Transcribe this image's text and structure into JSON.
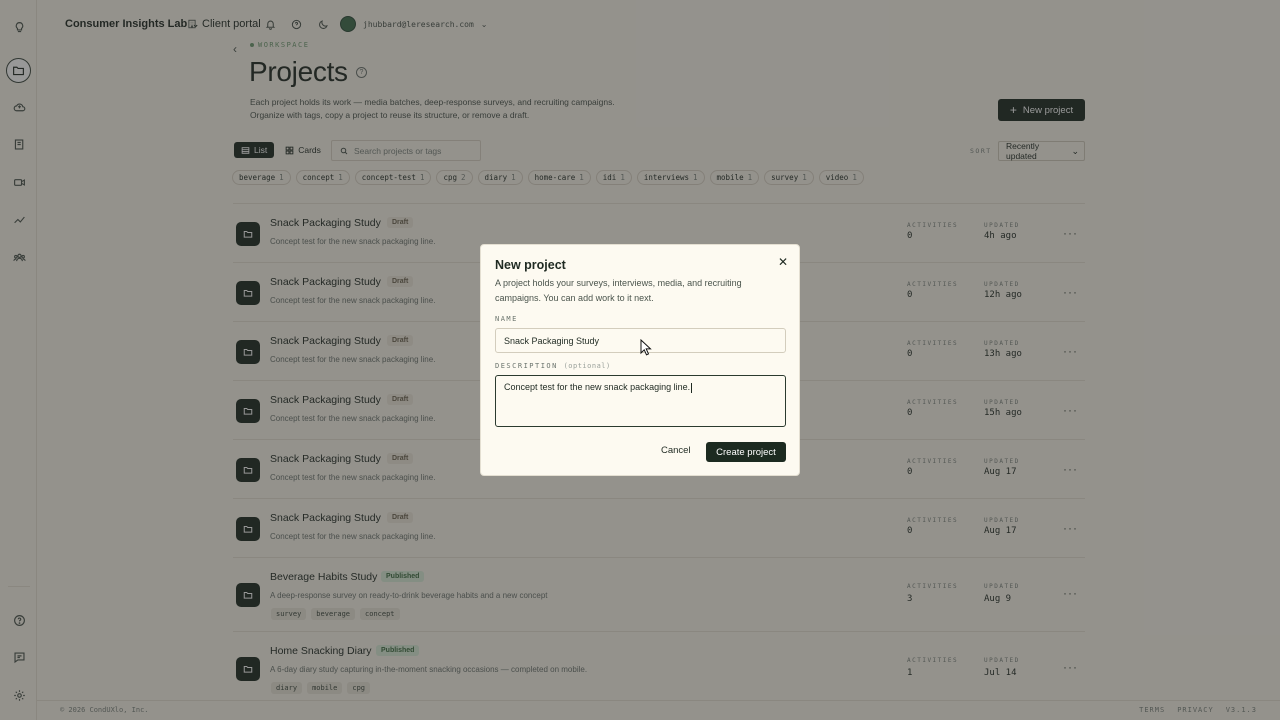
{
  "topbar": {
    "org_name": "Consumer Insights Lab",
    "portal_label": "Client portal",
    "user_email": "jhubbard@leresearch.com"
  },
  "page": {
    "eyebrow": "WORKSPACE",
    "title": "Projects",
    "subtitle_line1": "Each project holds its work — media batches, deep-response surveys, and recruiting campaigns.",
    "subtitle_line2": "Organize with tags, copy a project to reuse its structure, or remove a draft.",
    "new_project_label": "New project"
  },
  "toolbar": {
    "list_label": "List",
    "cards_label": "Cards",
    "search_placeholder": "Search projects or tags",
    "sort_label": "SORT",
    "sort_value": "Recently updated"
  },
  "tag_filters": [
    {
      "name": "beverage",
      "count": "1"
    },
    {
      "name": "concept",
      "count": "1"
    },
    {
      "name": "concept-test",
      "count": "1"
    },
    {
      "name": "cpg",
      "count": "2"
    },
    {
      "name": "diary",
      "count": "1"
    },
    {
      "name": "home-care",
      "count": "1"
    },
    {
      "name": "idi",
      "count": "1"
    },
    {
      "name": "interviews",
      "count": "1"
    },
    {
      "name": "mobile",
      "count": "1"
    },
    {
      "name": "survey",
      "count": "1"
    },
    {
      "name": "video",
      "count": "1"
    }
  ],
  "columns": {
    "activities": "ACTIVITIES",
    "updated": "UPDATED"
  },
  "projects": [
    {
      "title": "Snack Packaging Study",
      "status": "Draft",
      "desc": "Concept test for the new snack packaging line.",
      "activities": "0",
      "updated": "4h ago",
      "tags": []
    },
    {
      "title": "Snack Packaging Study",
      "status": "Draft",
      "desc": "Concept test for the new snack packaging line.",
      "activities": "0",
      "updated": "12h ago",
      "tags": []
    },
    {
      "title": "Snack Packaging Study",
      "status": "Draft",
      "desc": "Concept test for the new snack packaging line.",
      "activities": "0",
      "updated": "13h ago",
      "tags": []
    },
    {
      "title": "Snack Packaging Study",
      "status": "Draft",
      "desc": "Concept test for the new snack packaging line.",
      "activities": "0",
      "updated": "15h ago",
      "tags": []
    },
    {
      "title": "Snack Packaging Study",
      "status": "Draft",
      "desc": "Concept test for the new snack packaging line.",
      "activities": "0",
      "updated": "Aug 17",
      "tags": []
    },
    {
      "title": "Snack Packaging Study",
      "status": "Draft",
      "desc": "Concept test for the new snack packaging line.",
      "activities": "0",
      "updated": "Aug 17",
      "tags": []
    },
    {
      "title": "Beverage Habits Study",
      "status": "Published",
      "desc": "A deep-response survey on ready-to-drink beverage habits and a new concept",
      "activities": "3",
      "updated": "Aug 9",
      "tags": [
        "survey",
        "beverage",
        "concept"
      ]
    },
    {
      "title": "Home Snacking Diary",
      "status": "Published",
      "desc": "A 6-day diary study capturing in-the-moment snacking occasions — completed on mobile.",
      "activities": "1",
      "updated": "Jul 14",
      "tags": [
        "diary",
        "mobile",
        "cpg"
      ]
    }
  ],
  "footer": {
    "copyright": "© 2026 CondUXlo, Inc.",
    "terms": "TERMS",
    "privacy": "PRIVACY",
    "version": "V3.1.3"
  },
  "modal": {
    "title": "New project",
    "subtitle": "A project holds your surveys, interviews, media, and recruiting campaigns. You can add work to it next.",
    "name_label": "NAME",
    "name_value": "Snack Packaging Study",
    "description_label": "DESCRIPTION",
    "description_optional": "(optional)",
    "description_value": "Concept test for the new snack packaging line.",
    "cancel_label": "Cancel",
    "create_label": "Create project"
  },
  "colors": {
    "background": "#f7f3e9",
    "primary": "#1c2a20",
    "published_badge": "#d8ebd6",
    "draft_badge": "#ece7d9"
  }
}
